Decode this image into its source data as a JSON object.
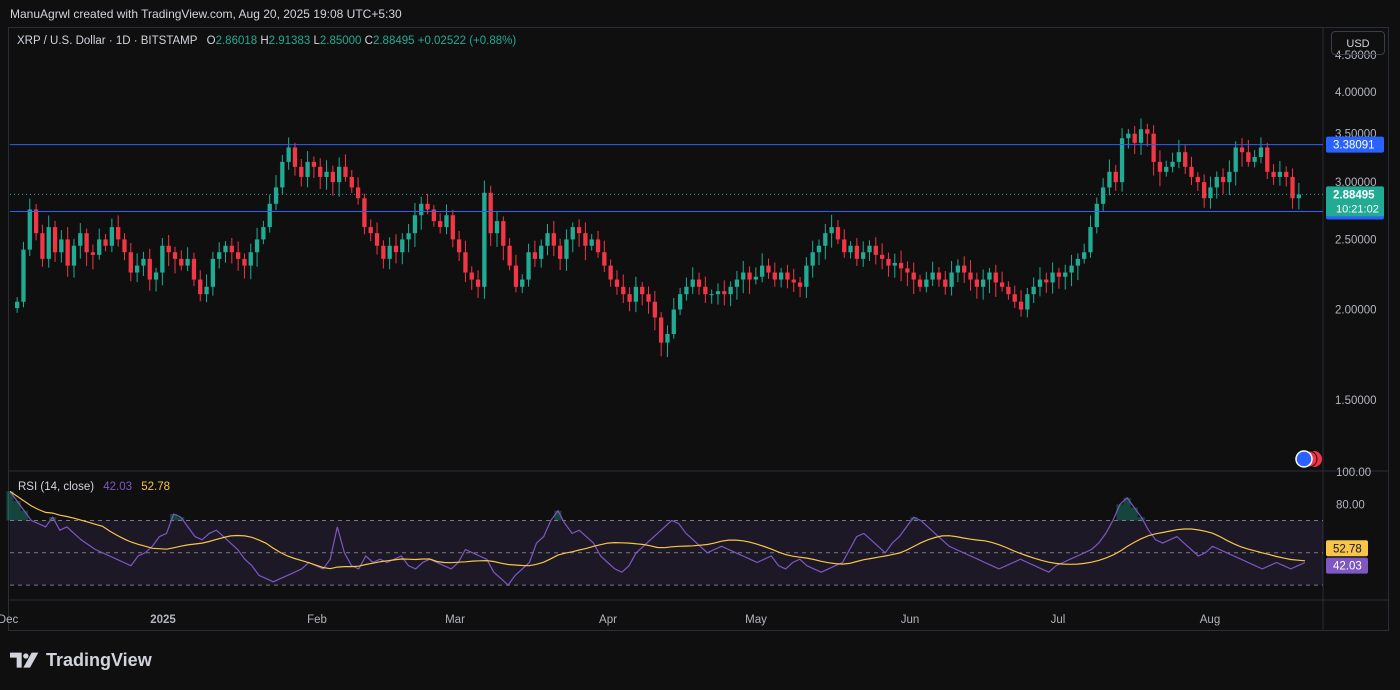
{
  "header": {
    "credit": "ManuAgrwl created with TradingView.com, Aug 20, 2025 19:08 UTC+5:30"
  },
  "legend": {
    "symbol": "XRP / U.S. Dollar · 1D · BITSTAMP",
    "open_label": "O",
    "open": "2.86018",
    "high_label": "H",
    "high": "2.91383",
    "low_label": "L",
    "low": "2.85000",
    "close_label": "C",
    "close": "2.88495",
    "change": "+0.02522 (+0.88%)"
  },
  "currency_button": "USD",
  "rsi_legend": {
    "label": "RSI (14, close)",
    "rsi_value": "42.03",
    "ma_value": "52.78"
  },
  "brand": "TradingView",
  "colors": {
    "up": "#22ab94",
    "down": "#f23645",
    "level_line": "#2962ff",
    "rsi_line": "#7e57c2",
    "rsi_ma": "#f7c548"
  },
  "chart_data": [
    {
      "type": "candlestick",
      "y_ticks": [
        "4.50000",
        "4.00000",
        "3.50000",
        "3.00000",
        "2.50000",
        "2.00000",
        "1.50000"
      ],
      "y_tick_values": [
        4.5,
        4.0,
        3.5,
        3.0,
        2.5,
        2.0,
        1.5
      ],
      "ylim": [
        1.2,
        4.9
      ],
      "x_ticks": [
        "Dec",
        "2025",
        "Feb",
        "Mar",
        "Apr",
        "May",
        "Jun",
        "Jul",
        "Aug"
      ],
      "levels": [
        {
          "value": 3.38091,
          "label": "3.38091"
        },
        {
          "value": 2.7323,
          "label": "2.73230"
        }
      ],
      "last_price": {
        "value": 2.88495,
        "label": "2.88495",
        "countdown": "10:21:02"
      },
      "close_series": [
        2.05,
        2.42,
        2.75,
        2.55,
        2.35,
        2.6,
        2.4,
        2.5,
        2.3,
        2.45,
        2.55,
        2.4,
        2.38,
        2.5,
        2.45,
        2.6,
        2.5,
        2.4,
        2.25,
        2.3,
        2.35,
        2.2,
        2.25,
        2.45,
        2.4,
        2.35,
        2.3,
        2.35,
        2.2,
        2.1,
        2.15,
        2.35,
        2.4,
        2.45,
        2.4,
        2.35,
        2.3,
        2.4,
        2.5,
        2.6,
        2.8,
        2.95,
        3.2,
        3.35,
        3.15,
        3.05,
        3.2,
        3.15,
        3.05,
        3.1,
        3.0,
        3.15,
        3.05,
        2.95,
        2.85,
        2.6,
        2.55,
        2.45,
        2.35,
        2.45,
        2.4,
        2.5,
        2.55,
        2.7,
        2.8,
        2.75,
        2.65,
        2.6,
        2.7,
        2.5,
        2.4,
        2.25,
        2.2,
        2.15,
        2.9,
        2.55,
        2.65,
        2.45,
        2.3,
        2.15,
        2.2,
        2.4,
        2.35,
        2.45,
        2.55,
        2.45,
        2.35,
        2.5,
        2.6,
        2.55,
        2.45,
        2.5,
        2.4,
        2.3,
        2.2,
        2.15,
        2.1,
        2.05,
        2.15,
        2.1,
        2.05,
        1.95,
        1.8,
        1.85,
        2.0,
        2.1,
        2.15,
        2.2,
        2.15,
        2.1,
        2.1,
        2.12,
        2.1,
        2.15,
        2.2,
        2.25,
        2.2,
        2.22,
        2.3,
        2.25,
        2.2,
        2.25,
        2.2,
        2.18,
        2.15,
        2.3,
        2.4,
        2.45,
        2.55,
        2.6,
        2.5,
        2.4,
        2.45,
        2.35,
        2.4,
        2.45,
        2.38,
        2.35,
        2.3,
        2.32,
        2.28,
        2.25,
        2.2,
        2.15,
        2.2,
        2.25,
        2.2,
        2.15,
        2.25,
        2.3,
        2.25,
        2.2,
        2.15,
        2.2,
        2.25,
        2.18,
        2.15,
        2.1,
        2.05,
        2.0,
        2.1,
        2.15,
        2.2,
        2.18,
        2.25,
        2.22,
        2.25,
        2.3,
        2.35,
        2.4,
        2.6,
        2.8,
        2.95,
        3.1,
        3.0,
        3.45,
        3.5,
        3.4,
        3.55,
        3.5,
        3.2,
        3.1,
        3.15,
        3.2,
        3.3,
        3.15,
        3.05,
        3.0,
        2.85,
        2.95,
        3.05,
        3.0,
        3.1,
        3.35,
        3.3,
        3.2,
        3.25,
        3.35,
        3.1,
        3.05,
        3.1,
        3.05,
        2.85,
        2.88495
      ]
    },
    {
      "type": "line",
      "name": "RSI (14, close)",
      "y_ticks": [
        "100.00",
        "80.00"
      ],
      "y_tick_values": [
        100,
        80
      ],
      "bands": [
        70,
        50,
        30
      ],
      "ylim": [
        22,
        100
      ],
      "current": {
        "rsi": "42.03",
        "ma": "52.78",
        "rsi_value": 42.03,
        "ma_value": 52.78
      },
      "rsi_series": [
        88,
        82,
        76,
        70,
        68,
        66,
        72,
        64,
        66,
        62,
        58,
        55,
        52,
        50,
        48,
        46,
        44,
        42,
        48,
        50,
        54,
        60,
        62,
        74,
        72,
        66,
        60,
        58,
        62,
        64,
        60,
        56,
        52,
        46,
        42,
        36,
        34,
        32,
        34,
        36,
        38,
        40,
        44,
        42,
        40,
        46,
        66,
        50,
        42,
        40,
        48,
        44,
        46,
        44,
        46,
        48,
        42,
        40,
        44,
        46,
        44,
        42,
        40,
        44,
        52,
        50,
        48,
        46,
        38,
        34,
        30,
        36,
        40,
        44,
        56,
        60,
        70,
        76,
        68,
        62,
        64,
        60,
        56,
        48,
        44,
        40,
        38,
        42,
        50,
        54,
        58,
        62,
        66,
        70,
        68,
        62,
        58,
        54,
        50,
        52,
        54,
        52,
        50,
        48,
        46,
        44,
        46,
        48,
        42,
        40,
        44,
        46,
        42,
        40,
        38,
        40,
        42,
        44,
        52,
        60,
        62,
        58,
        54,
        50,
        56,
        60,
        66,
        72,
        70,
        66,
        62,
        58,
        54,
        52,
        50,
        48,
        46,
        44,
        42,
        40,
        42,
        44,
        46,
        44,
        42,
        40,
        38,
        42,
        44,
        46,
        48,
        50,
        52,
        56,
        62,
        70,
        80,
        84,
        78,
        72,
        64,
        58,
        56,
        58,
        60,
        56,
        52,
        48,
        50,
        54,
        52,
        50,
        48,
        46,
        44,
        42,
        40,
        42,
        44,
        42,
        40,
        42,
        44
      ]
    }
  ]
}
